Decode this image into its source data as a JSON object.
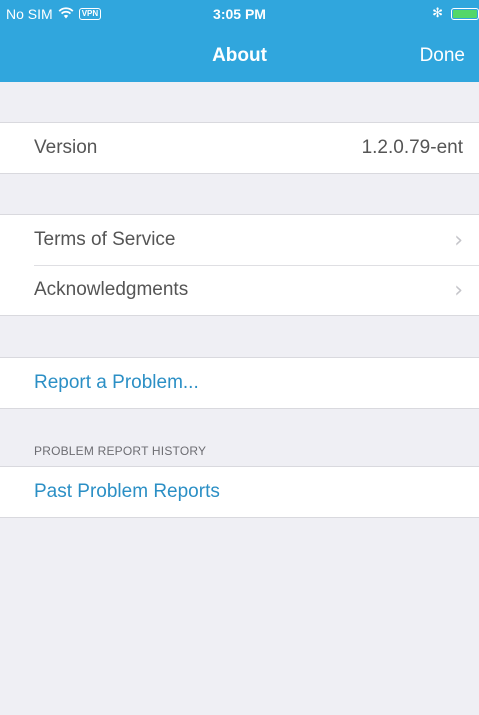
{
  "status_bar": {
    "carrier": "No SIM",
    "vpn": "VPN",
    "time": "3:05 PM",
    "bluetooth": "✻"
  },
  "nav": {
    "title": "About",
    "done_label": "Done"
  },
  "version_group": {
    "label": "Version",
    "value": "1.2.0.79-ent"
  },
  "info_group": {
    "items": [
      {
        "label": "Terms of Service",
        "chevron": "›"
      },
      {
        "label": "Acknowledgments",
        "chevron": "›"
      }
    ]
  },
  "report": {
    "label": "Report a Problem..."
  },
  "history": {
    "section_header": "PROBLEM REPORT HISTORY",
    "label": "Past Problem Reports"
  },
  "colors": {
    "nav_background": "#30a6dd",
    "link": "#2b8fc5",
    "page_background": "#efeff4",
    "battery_fill": "#53d769"
  },
  "icons": [
    "wifi-icon",
    "bluetooth-icon",
    "battery-icon",
    "chevron-right-icon"
  ]
}
